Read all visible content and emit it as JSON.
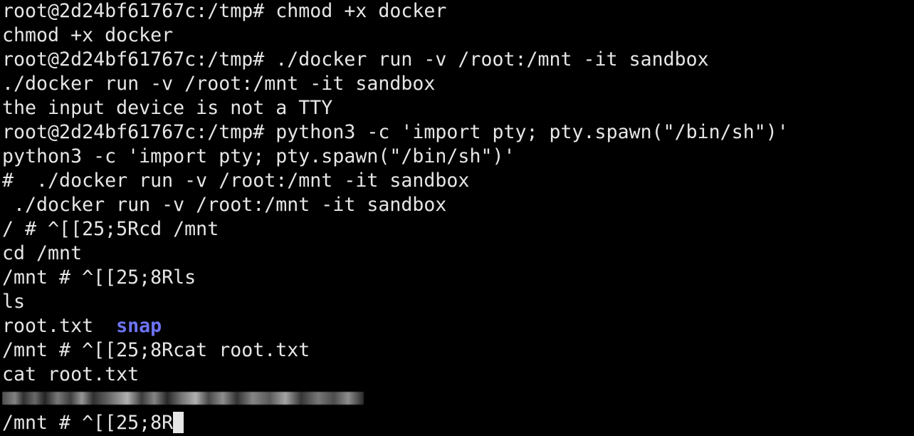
{
  "terminal": {
    "lines": [
      "root@2d24bf61767c:/tmp# chmod +x docker",
      "chmod +x docker",
      "root@2d24bf61767c:/tmp# ./docker run -v /root:/mnt -it sandbox",
      "./docker run -v /root:/mnt -it sandbox",
      "the input device is not a TTY",
      "root@2d24bf61767c:/tmp# python3 -c 'import pty; pty.spawn(\"/bin/sh\")'",
      "python3 -c 'import pty; pty.spawn(\"/bin/sh\")'",
      "#  ./docker run -v /root:/mnt -it sandbox",
      " ./docker run -v /root:/mnt -it sandbox",
      "/ # ^[[25;5Rcd /mnt",
      "cd /mnt",
      "/mnt # ^[[25;8Rls",
      "ls"
    ],
    "ls_output": {
      "file": "root.txt",
      "directory": "snap"
    },
    "after_ls": [
      "/mnt # ^[[25;8Rcat root.txt",
      "cat root.txt"
    ],
    "prompt_current": "/mnt # ^[[25;8R"
  },
  "colors": {
    "background": "#000000",
    "foreground": "#e6e6e6",
    "directory": "#6e74f5"
  }
}
